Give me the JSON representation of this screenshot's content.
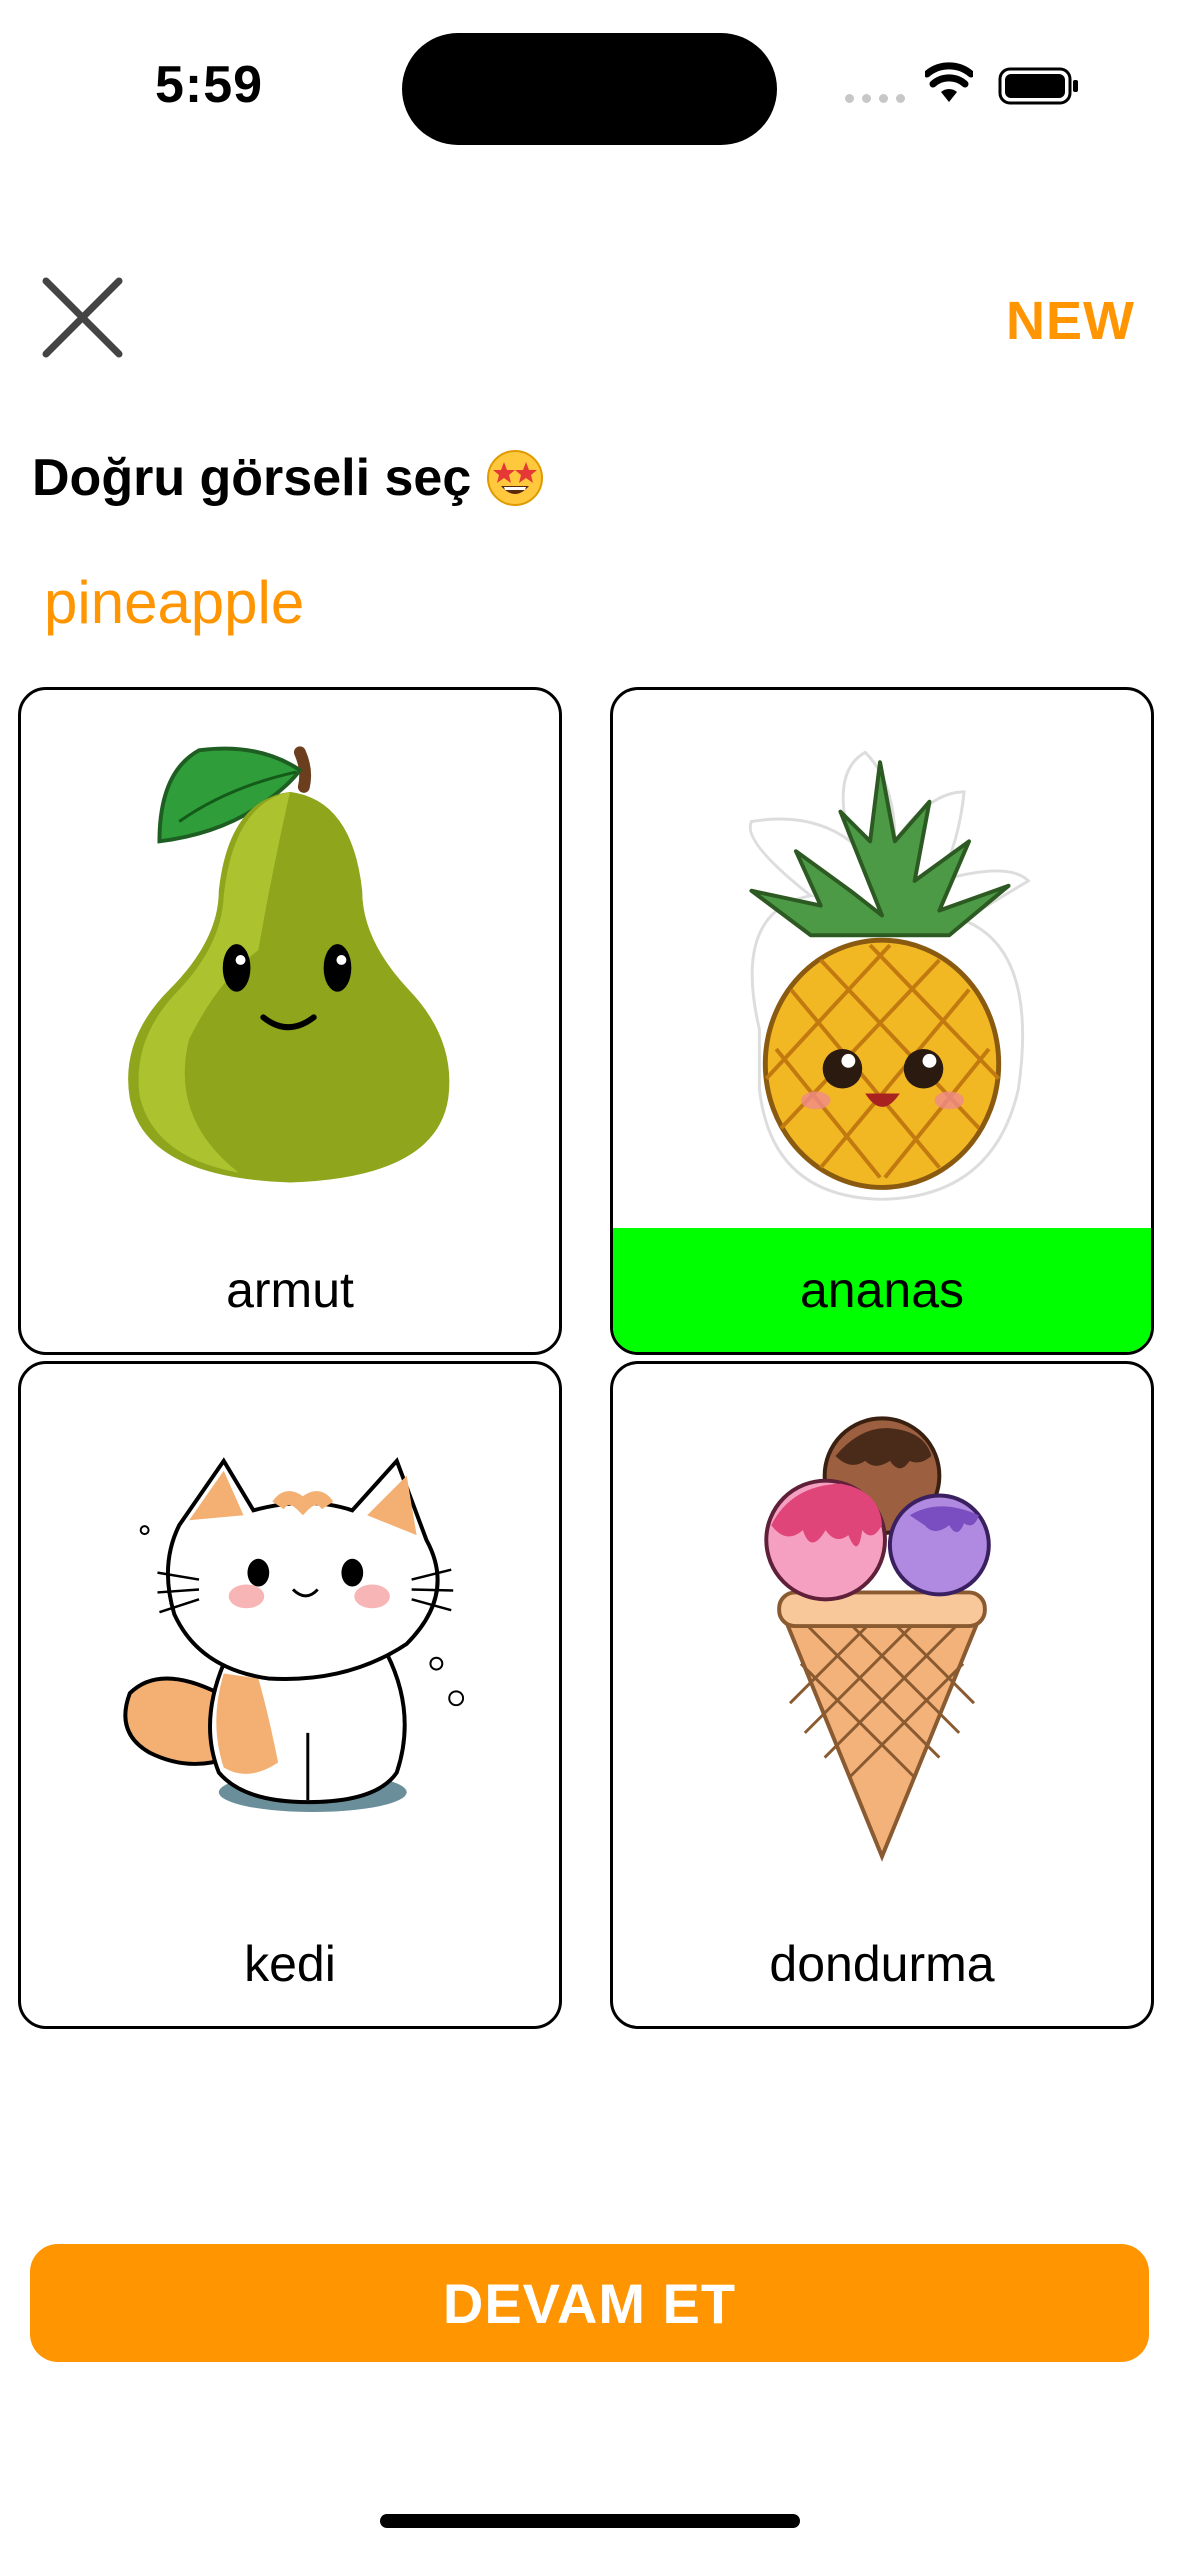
{
  "status_bar": {
    "time": "5:59"
  },
  "header": {
    "close_icon": "close-icon",
    "badge": "NEW"
  },
  "instruction": {
    "text": "Doğru görseli seç",
    "emoji": "star-struck-emoji"
  },
  "target_word": "pineapple",
  "options": [
    {
      "label": "armut",
      "image": "pear",
      "selected": false
    },
    {
      "label": "ananas",
      "image": "pineapple",
      "selected": true
    },
    {
      "label": "kedi",
      "image": "cat",
      "selected": false
    },
    {
      "label": "dondurma",
      "image": "ice-cream",
      "selected": false
    }
  ],
  "continue_button": {
    "label": "DEVAM ET"
  },
  "colors": {
    "accent": "#FF9500",
    "correct": "#00FF00",
    "card_border": "#000000"
  }
}
